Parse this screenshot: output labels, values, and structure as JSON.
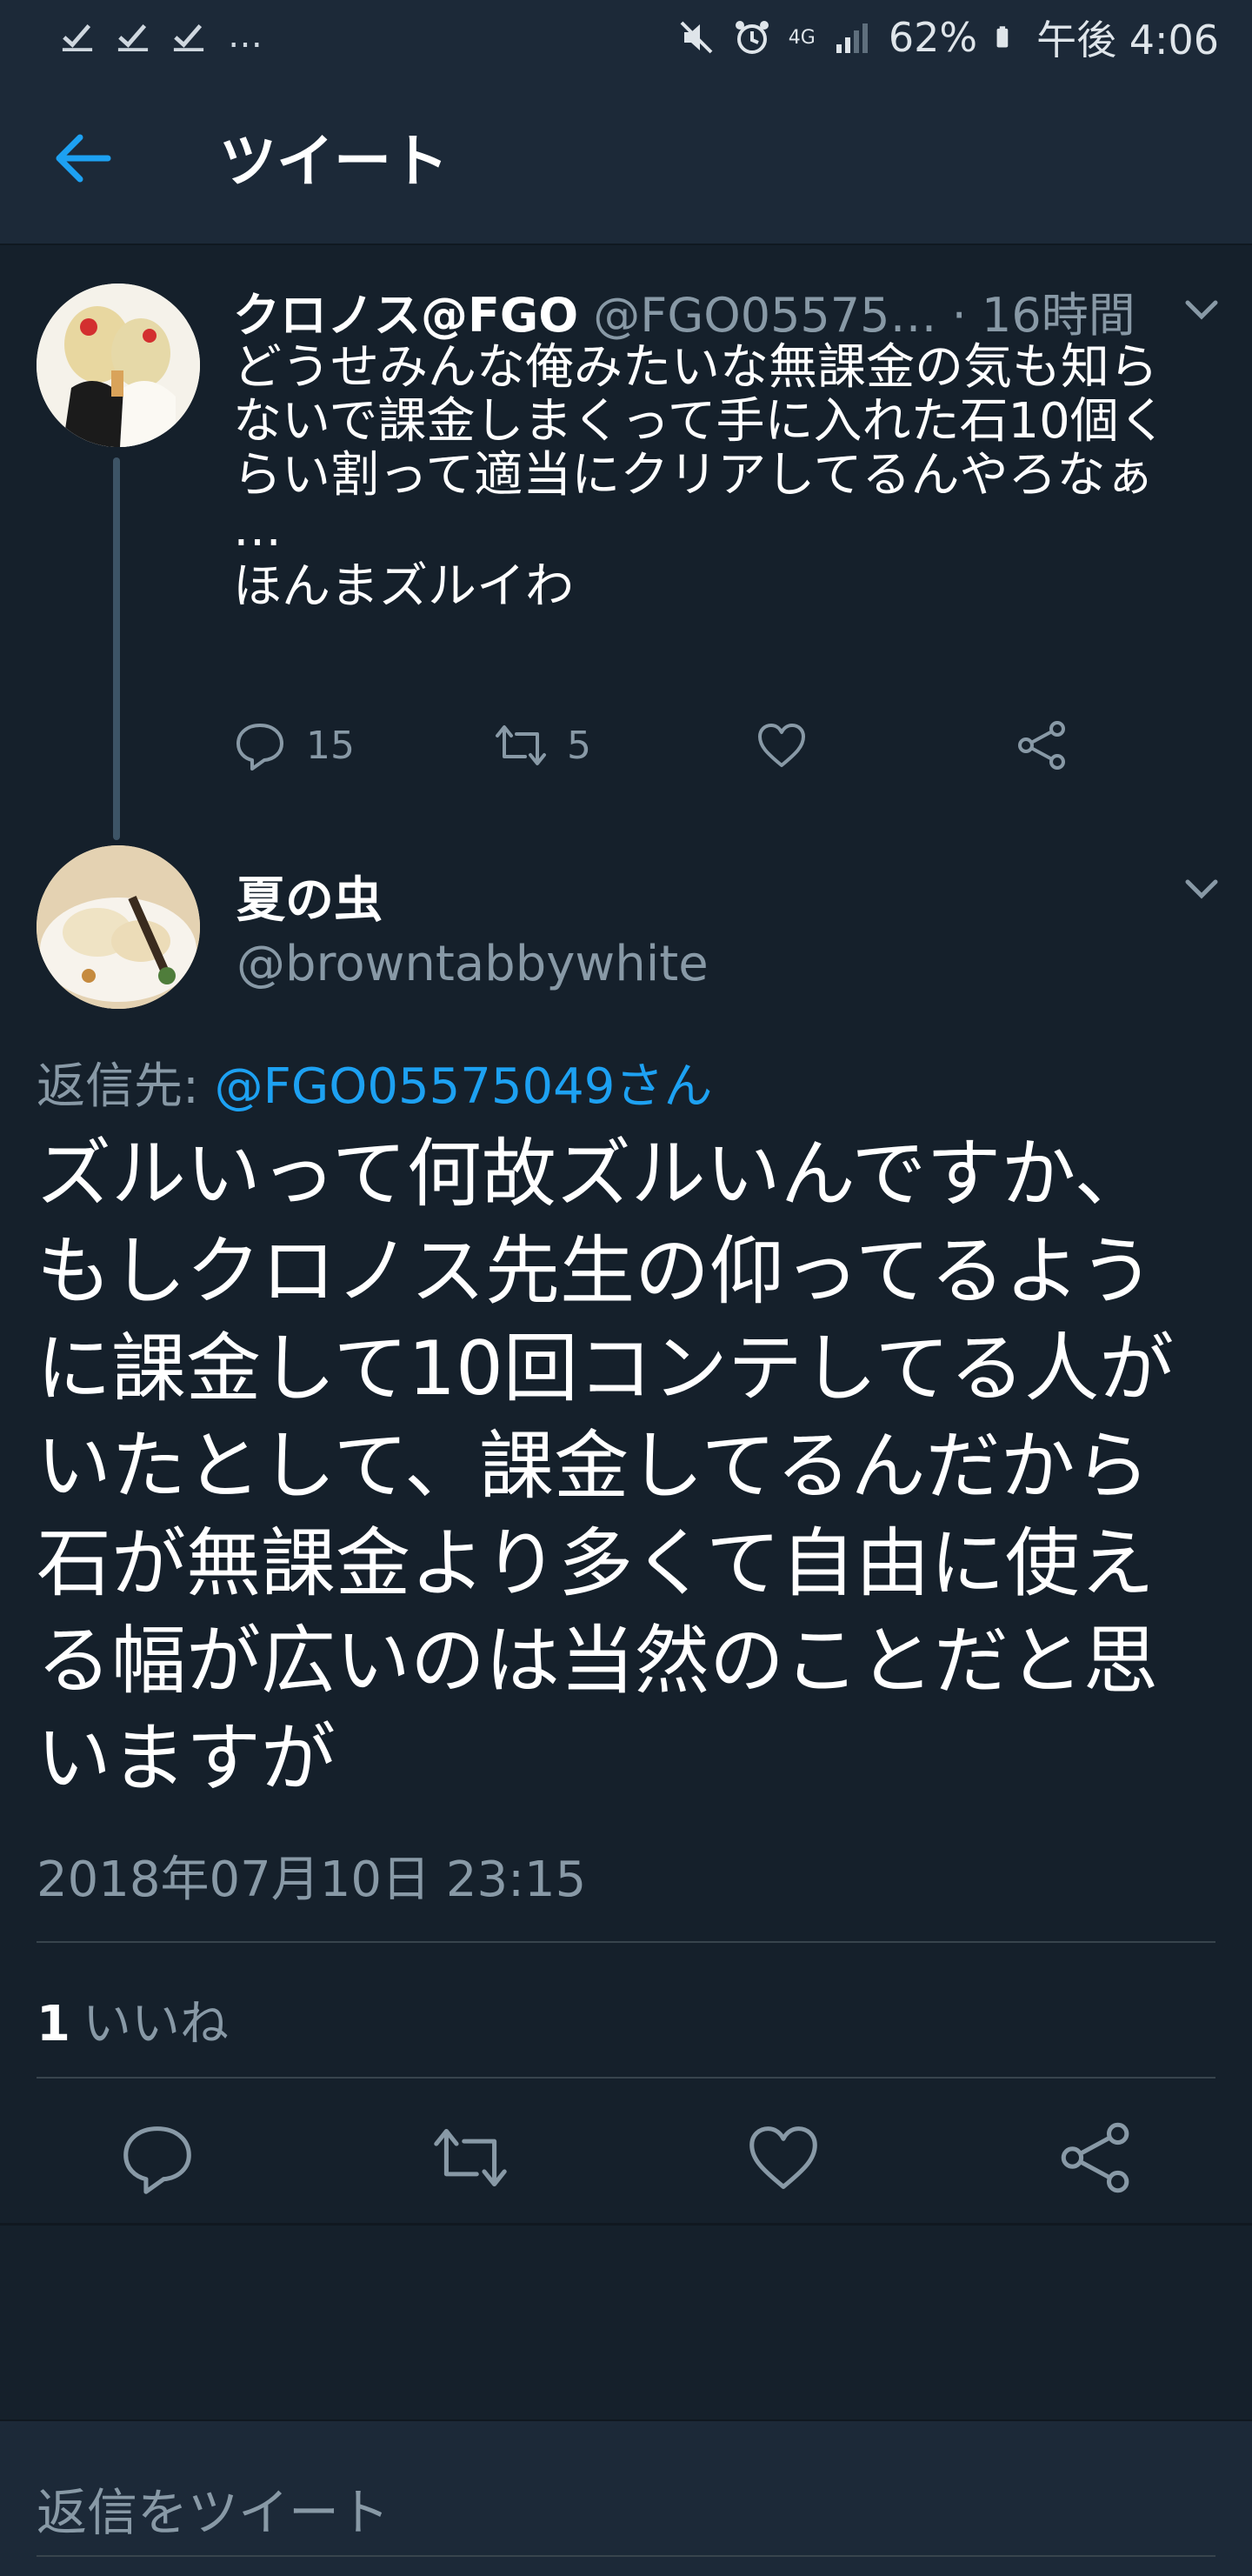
{
  "status_bar": {
    "dots": "…",
    "battery": "62%",
    "time": "午後 4:06",
    "network": "4G"
  },
  "header": {
    "title": "ツイート"
  },
  "parent_tweet": {
    "name": "クロノス@FGO",
    "handle": "@FGO05575…",
    "sep": " · ",
    "time": "16時間",
    "body_lines": [
      "どうせみんな俺みたいな無課金の気も知ら",
      "ないで課金しまくって手に入れた石10個く",
      "らい割って適当にクリアしてるんやろなぁ",
      "…",
      "ほんまズルイわ"
    ],
    "reply_count": "15",
    "retweet_count": "5"
  },
  "main_tweet": {
    "name": "夏の虫",
    "handle": "@browntabbywhite",
    "reply_to_label": "返信先: ",
    "reply_to_user": "@FGO05575049さん",
    "body_lines": [
      "ズルいって何故ズルいんですか、",
      "もしクロノス先生の仰ってるよう",
      "に課金して10回コンテしてる人が",
      "いたとして、課金してるんだから",
      "石が無課金より多くて自由に使え",
      "る幅が広いのは当然のことだと思",
      "いますが"
    ],
    "timestamp": "2018年07月10日 23:15",
    "like_count": "1",
    "like_label": "いいね"
  },
  "reply_box": {
    "placeholder": "返信をツイート"
  },
  "colors": {
    "background": "#15202b",
    "bar": "#1c2938",
    "accent": "#1da1f2",
    "secondary_text": "#8899a6"
  },
  "icons": [
    "check-icon",
    "mute-icon",
    "alarm-icon",
    "signal-icon",
    "battery-icon",
    "back-arrow-icon",
    "chevron-down-icon",
    "reply-icon",
    "retweet-icon",
    "like-icon",
    "share-icon"
  ]
}
